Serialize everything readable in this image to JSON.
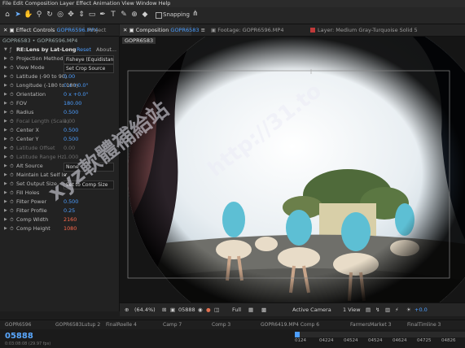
{
  "menubar": {
    "text": "File Edit Composition Layer Effect Animation View Window Help"
  },
  "toolbar": {
    "tools": [
      "home-icon",
      "selection-icon",
      "hand-icon",
      "zoom-icon",
      "rotate-icon",
      "camera-orbit-icon",
      "pan-icon",
      "dolly-icon",
      "rect-mask-icon",
      "pen-icon",
      "type-icon",
      "brush-icon",
      "clone-icon",
      "eraser-icon",
      "roto-icon",
      "puppet-icon"
    ],
    "snapping_label": "Snapping"
  },
  "panels": {
    "effect_controls_tab": "Effect Controls",
    "effect_controls_layer": "GOPR6596.MP4",
    "project_tab": "Project",
    "composition_tab": "Composition",
    "composition_name": "GOPR6583",
    "footage_tab": "Footage: GOPR6596.MP4",
    "layer_tab": "Layer: Medium Gray-Turquoise Solid 5",
    "comp_subtab": "GOPR6583"
  },
  "effect": {
    "breadcrumb": "GOPR6583 • GOPR6596.MP4",
    "name": "RE:Lens by Lat-Long",
    "reset": "Reset",
    "about": "About...",
    "rows": [
      {
        "label": "Projection Method",
        "value": "Fisheye (Equidistant)",
        "kind": "dropdown"
      },
      {
        "label": "View Mode",
        "value": "Set Crop Source",
        "kind": "dropdown"
      },
      {
        "label": "Latitude (-90 to 90)",
        "value": "0.00",
        "kind": "num"
      },
      {
        "label": "Longitude (-180 to 180)",
        "value": "0 x +0.0°",
        "kind": "num"
      },
      {
        "label": "Orientation",
        "value": "0 x +0.0°",
        "kind": "num"
      },
      {
        "label": "FOV",
        "value": "180.00",
        "kind": "num"
      },
      {
        "label": "Radius",
        "value": "0.500",
        "kind": "num"
      },
      {
        "label": "Focal Length (Scale)",
        "value": "1.00",
        "kind": "dim"
      },
      {
        "label": "Center X",
        "value": "0.500",
        "kind": "num"
      },
      {
        "label": "Center Y",
        "value": "0.500",
        "kind": "num"
      },
      {
        "label": "Latitude Offset",
        "value": "0.00",
        "kind": "dim"
      },
      {
        "label": "Latitude Range Hz",
        "value": "1.000",
        "kind": "dim"
      },
      {
        "label": "Alt Source",
        "value": "None",
        "kind": "dropdown"
      },
      {
        "label": "Maintain Lat Self In",
        "value": "✓",
        "kind": "check"
      },
      {
        "label": "Set Output Size",
        "value": "Set to Comp Size",
        "kind": "dropdown"
      },
      {
        "label": "Fill Holes",
        "value": "",
        "kind": "plain"
      },
      {
        "label": "Filter Power",
        "value": "0.500",
        "kind": "num"
      },
      {
        "label": "Filter Profile",
        "value": "0.25",
        "kind": "num"
      },
      {
        "label": "Comp Width",
        "value": "2160",
        "kind": "red"
      },
      {
        "label": "Comp Height",
        "value": "1080",
        "kind": "red"
      }
    ]
  },
  "compbar": {
    "zoom": "(64.4%)",
    "timecode": "05888",
    "resolution": "Full",
    "camera": "Active Camera",
    "views": "1 View",
    "exposure": "+0.0"
  },
  "timeline_tabs": [
    "GOPR6596",
    "GOPR6583Lutup 2",
    "FinalRoelle 4",
    "Camp 7",
    "Comp 3",
    "GOPR6419.MP4 Comp 6",
    "FarmersMarket 3",
    "FinalTimline 3"
  ],
  "timeline": {
    "current_time": "05888",
    "sub": "0:03:08:08 (29.97 fps)",
    "ruler_ticks": [
      "0124",
      "04224",
      "04524",
      "04524",
      "04624",
      "04725",
      "04826"
    ]
  },
  "watermark": {
    "line1": "xyz軟體補給站",
    "line2": "http://31.to"
  },
  "colors": {
    "accent": "#4d9eff",
    "layer_red": "#c03a3a",
    "highlight": "#6ab0ff"
  }
}
